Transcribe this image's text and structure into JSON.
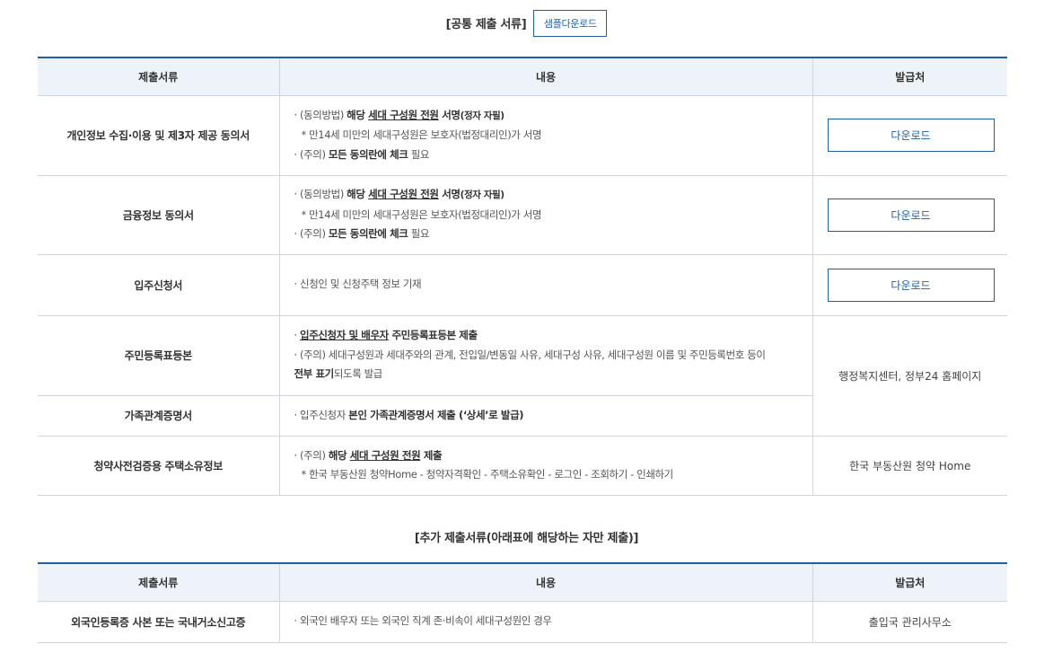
{
  "common": {
    "title": "[공통 제출 서류]",
    "sample_button": "샘플다운로드",
    "headers": {
      "doc": "제출서류",
      "content": "내용",
      "issuer": "발급처"
    },
    "rows": {
      "r1": {
        "doc": "개인정보 수집·이용 및 제3자 제공 동의서",
        "l1_a": "· (동의방법) ",
        "l1_b": "해당 ",
        "l1_c": "세대 구성원 전원",
        "l1_d": " 서명",
        "l1_e": "(정자 자필)",
        "l2": "* 만14세 미만의 세대구성원은 보호자(법정대리인)가 서명",
        "l3_a": "· (주의) ",
        "l3_b": "모든 동의란에 체크",
        "l3_c": " 필요",
        "button": "다운로드"
      },
      "r2": {
        "doc": "금융정보 동의서",
        "l1_a": "· (동의방법) ",
        "l1_b": "해당 ",
        "l1_c": "세대 구성원 전원",
        "l1_d": " 서명",
        "l1_e": "(정자 자필)",
        "l2": "* 만14세 미만의 세대구성원은 보호자(법정대리인)가 서명",
        "l3_a": "· (주의) ",
        "l3_b": "모든 동의란에 체크",
        "l3_c": " 필요",
        "button": "다운로드"
      },
      "r3": {
        "doc": "입주신청서",
        "l1": "· 신청인 및 신청주택 정보 기재",
        "button": "다운로드"
      },
      "r4": {
        "doc": "주민등록표등본",
        "l1_a": "· ",
        "l1_b": "입주신청자 및 배우자",
        "l1_c": " 주민등록표등본 제출",
        "l2": "· (주의) 세대구성원과 세대주와의 관계, 전입일/변동일 사유, 세대구성 사유, 세대구성원 이름 및 주민등록번호 등이",
        "l3_a": "전부 표기",
        "l3_b": "되도록 발급",
        "issuer": "행정복지센터, 정부24 홈페이지"
      },
      "r5": {
        "doc": "가족관계증명서",
        "l1_a": "· 입주신청자 ",
        "l1_b": "본인 가족관계증명서 제출 (‘상세’로 발급)"
      },
      "r6": {
        "doc": "청약사전검증용 주택소유정보",
        "l1_a": "· (주의) ",
        "l1_b": "해당 ",
        "l1_c": "세대 구성원 전원",
        "l1_d": " 제출",
        "l2": "* 한국 부동산원 청약Home - 청약자격확인 - 주택소유확인 - 로그인 - 조회하기 - 인쇄하기",
        "issuer": "한국 부동산원 청약 Home"
      }
    }
  },
  "additional": {
    "title": "[추가 제출서류(아래표에 해당하는 자만 제출)]",
    "headers": {
      "doc": "제출서류",
      "content": "내용",
      "issuer": "발급처"
    },
    "rows": {
      "r1": {
        "doc": "외국인등록증 사본 또는 국내거소신고증",
        "l1": "· 외국인 배우자 또는 외국인 직계 존·비속이 세대구성원인 경우",
        "issuer": "출입국 관리사무소"
      }
    }
  },
  "colors": {
    "accent": "#1f5fa8",
    "header_bg": "#eef3f9",
    "border": "#cfd6df"
  }
}
